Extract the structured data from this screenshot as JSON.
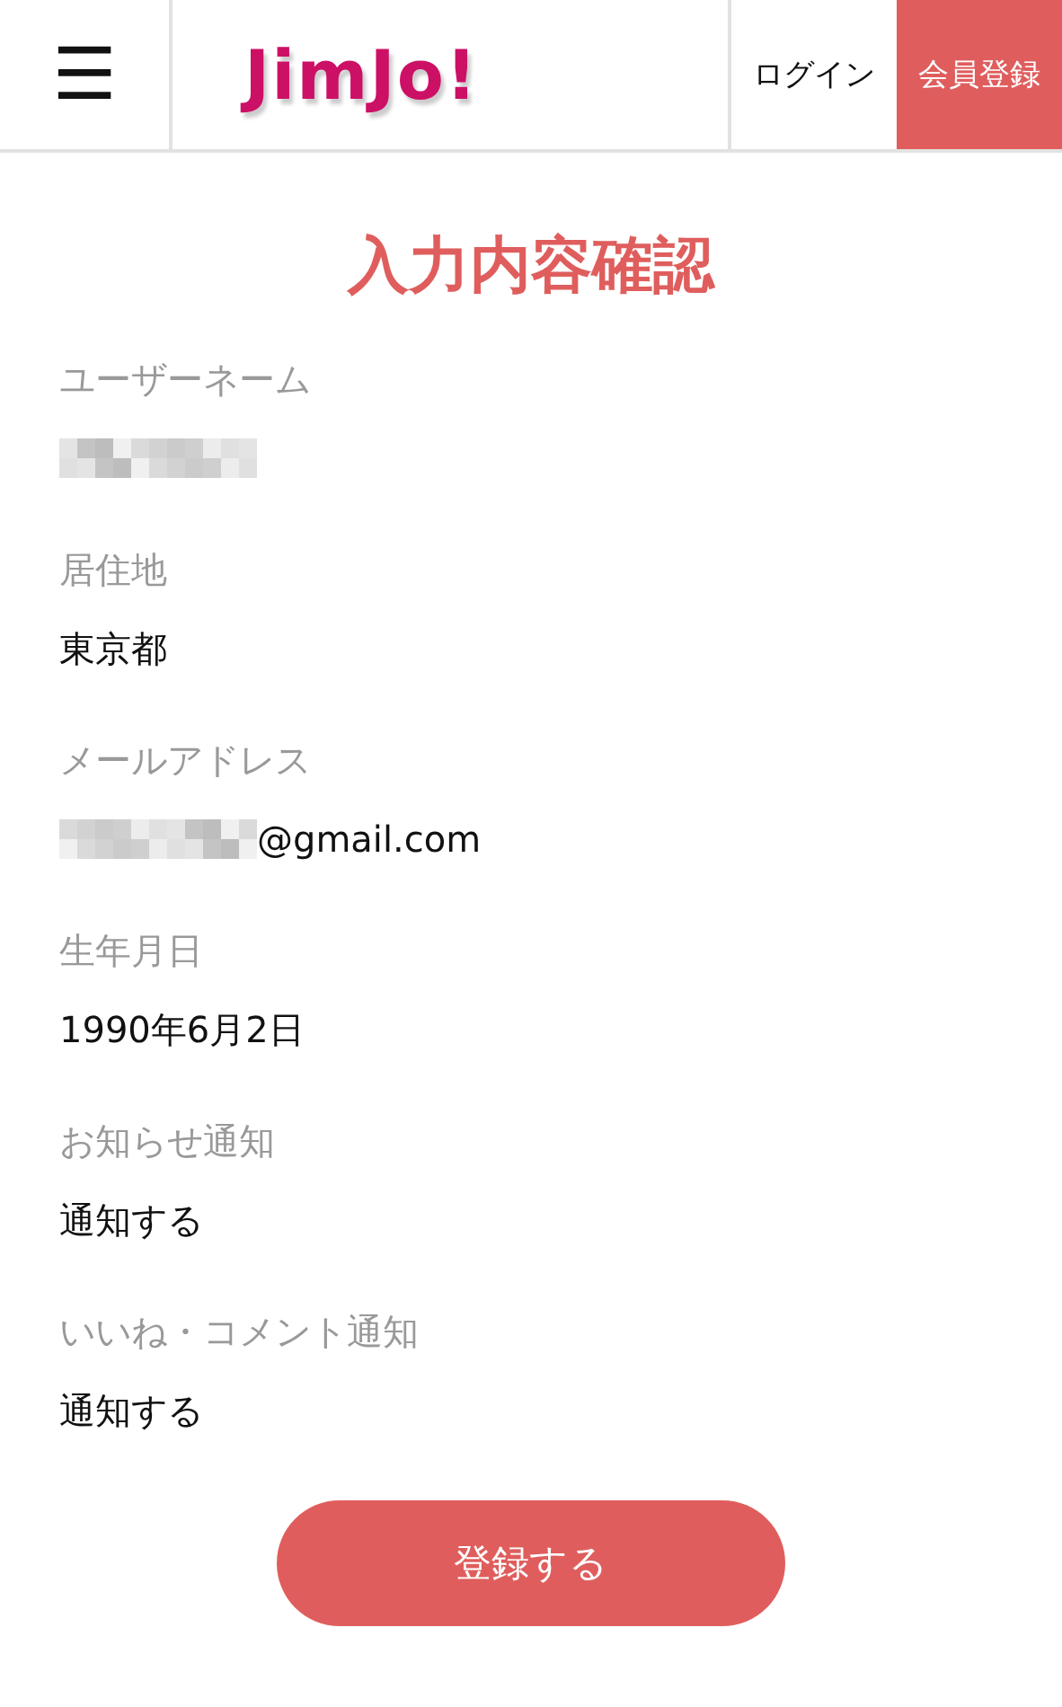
{
  "header": {
    "menu_icon": "☰",
    "logo": "JimJo!",
    "login": "ログイン",
    "register": "会員登録"
  },
  "title": "入力内容確認",
  "fields": [
    {
      "label": "ユーザーネーム",
      "masked": true
    },
    {
      "label": "居住地",
      "value": "東京都",
      "masked": false
    },
    {
      "label": "メールアドレス",
      "value": "@gmail.com",
      "masked": true
    },
    {
      "label": "生年月日",
      "value": "1990年6月2日",
      "masked": false
    },
    {
      "label": "お知らせ通知",
      "value": "通知する",
      "masked": false
    },
    {
      "label": "いいね・コメント通知",
      "value": "通知する",
      "masked": false
    }
  ],
  "submit": "登録する"
}
